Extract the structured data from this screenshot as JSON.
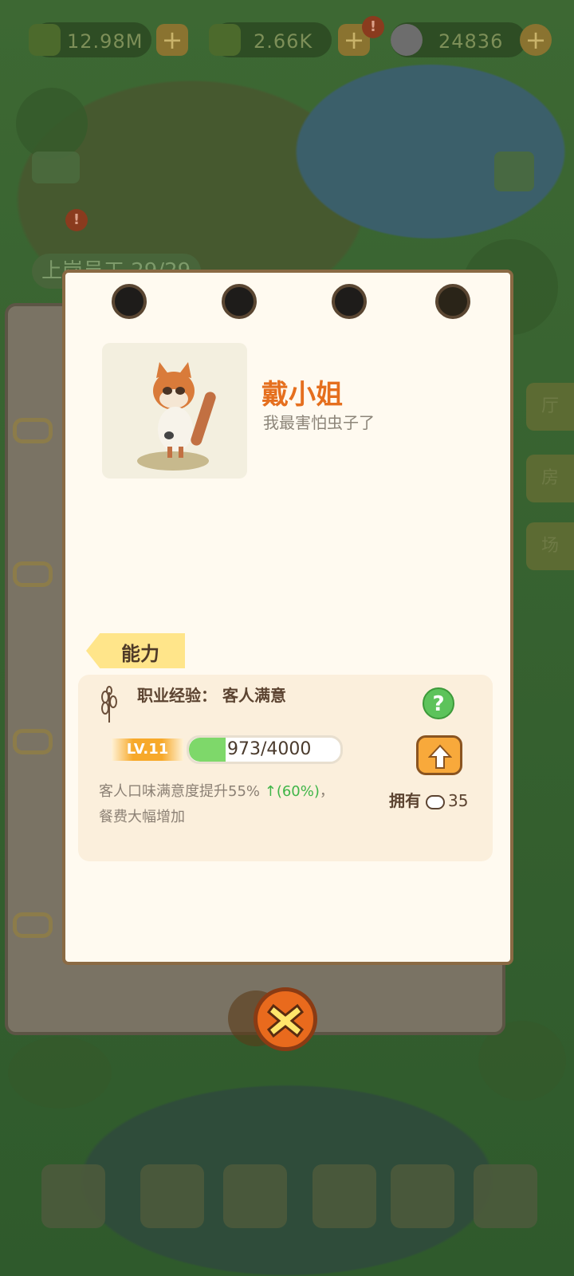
{
  "top_bar": {
    "coins": "12.98M",
    "leaves": "2.66K",
    "pandas": "24836"
  },
  "background": {
    "staff_label": "上岗员工 29/29",
    "side_tabs": [
      "厅",
      "房",
      "场"
    ],
    "badge_mark": "!"
  },
  "card": {
    "character_name": "戴小姐",
    "character_quote": "我最害怕虫子了",
    "section_tag": "能力",
    "skill": {
      "title": "职业经验：  客人满意",
      "level": "LV.11",
      "xp_text": "973/4000",
      "xp_progress": 0.2433,
      "help_label": "?",
      "desc_prefix": "客人口味满意度提升55%",
      "desc_boost": "↑(60%)",
      "desc_suffix": "，",
      "desc_line2": "餐费大幅增加",
      "owned_label": "拥有",
      "owned_count": "35"
    }
  },
  "colors": {
    "accent_orange": "#e56f1e",
    "progress_green": "#7ed86a",
    "card_bg": "#fffaf0"
  }
}
